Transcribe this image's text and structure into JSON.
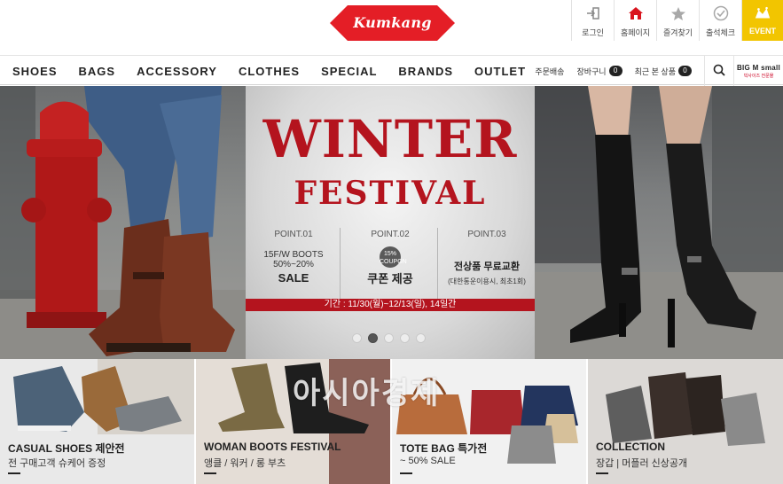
{
  "brand": {
    "logo_text": "Kumkang",
    "accent": "#e41e26"
  },
  "quick_menu": [
    {
      "label": "로그인",
      "icon": "login-icon"
    },
    {
      "label": "홈페이지",
      "icon": "home-icon"
    },
    {
      "label": "즐겨찾기",
      "icon": "star-icon"
    },
    {
      "label": "출석체크",
      "icon": "check-circle-icon"
    },
    {
      "label": "EVENT",
      "icon": "event-icon"
    }
  ],
  "nav": {
    "items": [
      "SHOES",
      "BAGS",
      "ACCESSORY",
      "CLOTHES",
      "SPECIAL",
      "BRANDS",
      "OUTLET"
    ],
    "links": {
      "shipping": "주문배송",
      "cart": "장바구니",
      "cart_count": "0",
      "recent": "최근 본 상품",
      "recent_count": "0"
    },
    "partner": {
      "name": "BIG M small",
      "sub": "빅사이즈 전문몰"
    }
  },
  "hero": {
    "title_1": "WINTER",
    "title_2": "FESTIVAL",
    "promos": [
      {
        "head": "POINT.01",
        "line1": "15F/W  BOOTS 50%~20%",
        "line2": "SALE"
      },
      {
        "head": "POINT.02",
        "badge": "15% COUPON",
        "line2": "쿠폰 제공"
      },
      {
        "head": "POINT.03",
        "line1": "전상품 무료교환",
        "line2": "(대한통운이용시, 최초1회)"
      }
    ],
    "period": "기간 : 11/30(월)~12/13(일), 14일간",
    "slide_count": 5,
    "active_slide": 2
  },
  "tiles": [
    {
      "title": "CASUAL SHOES 제안전",
      "subtitle": "전 구매고객 슈케어 증정"
    },
    {
      "title": "WOMAN BOOTS  FESTIVAL",
      "subtitle": "앵클 / 워커 / 롱 부츠"
    },
    {
      "title": "TOTE BAG 특가전",
      "subtitle": "~ 50% SALE"
    },
    {
      "title": "COLLECTION",
      "subtitle": "장갑 | 머플러 신상공개"
    }
  ],
  "watermark": "아시아경제"
}
